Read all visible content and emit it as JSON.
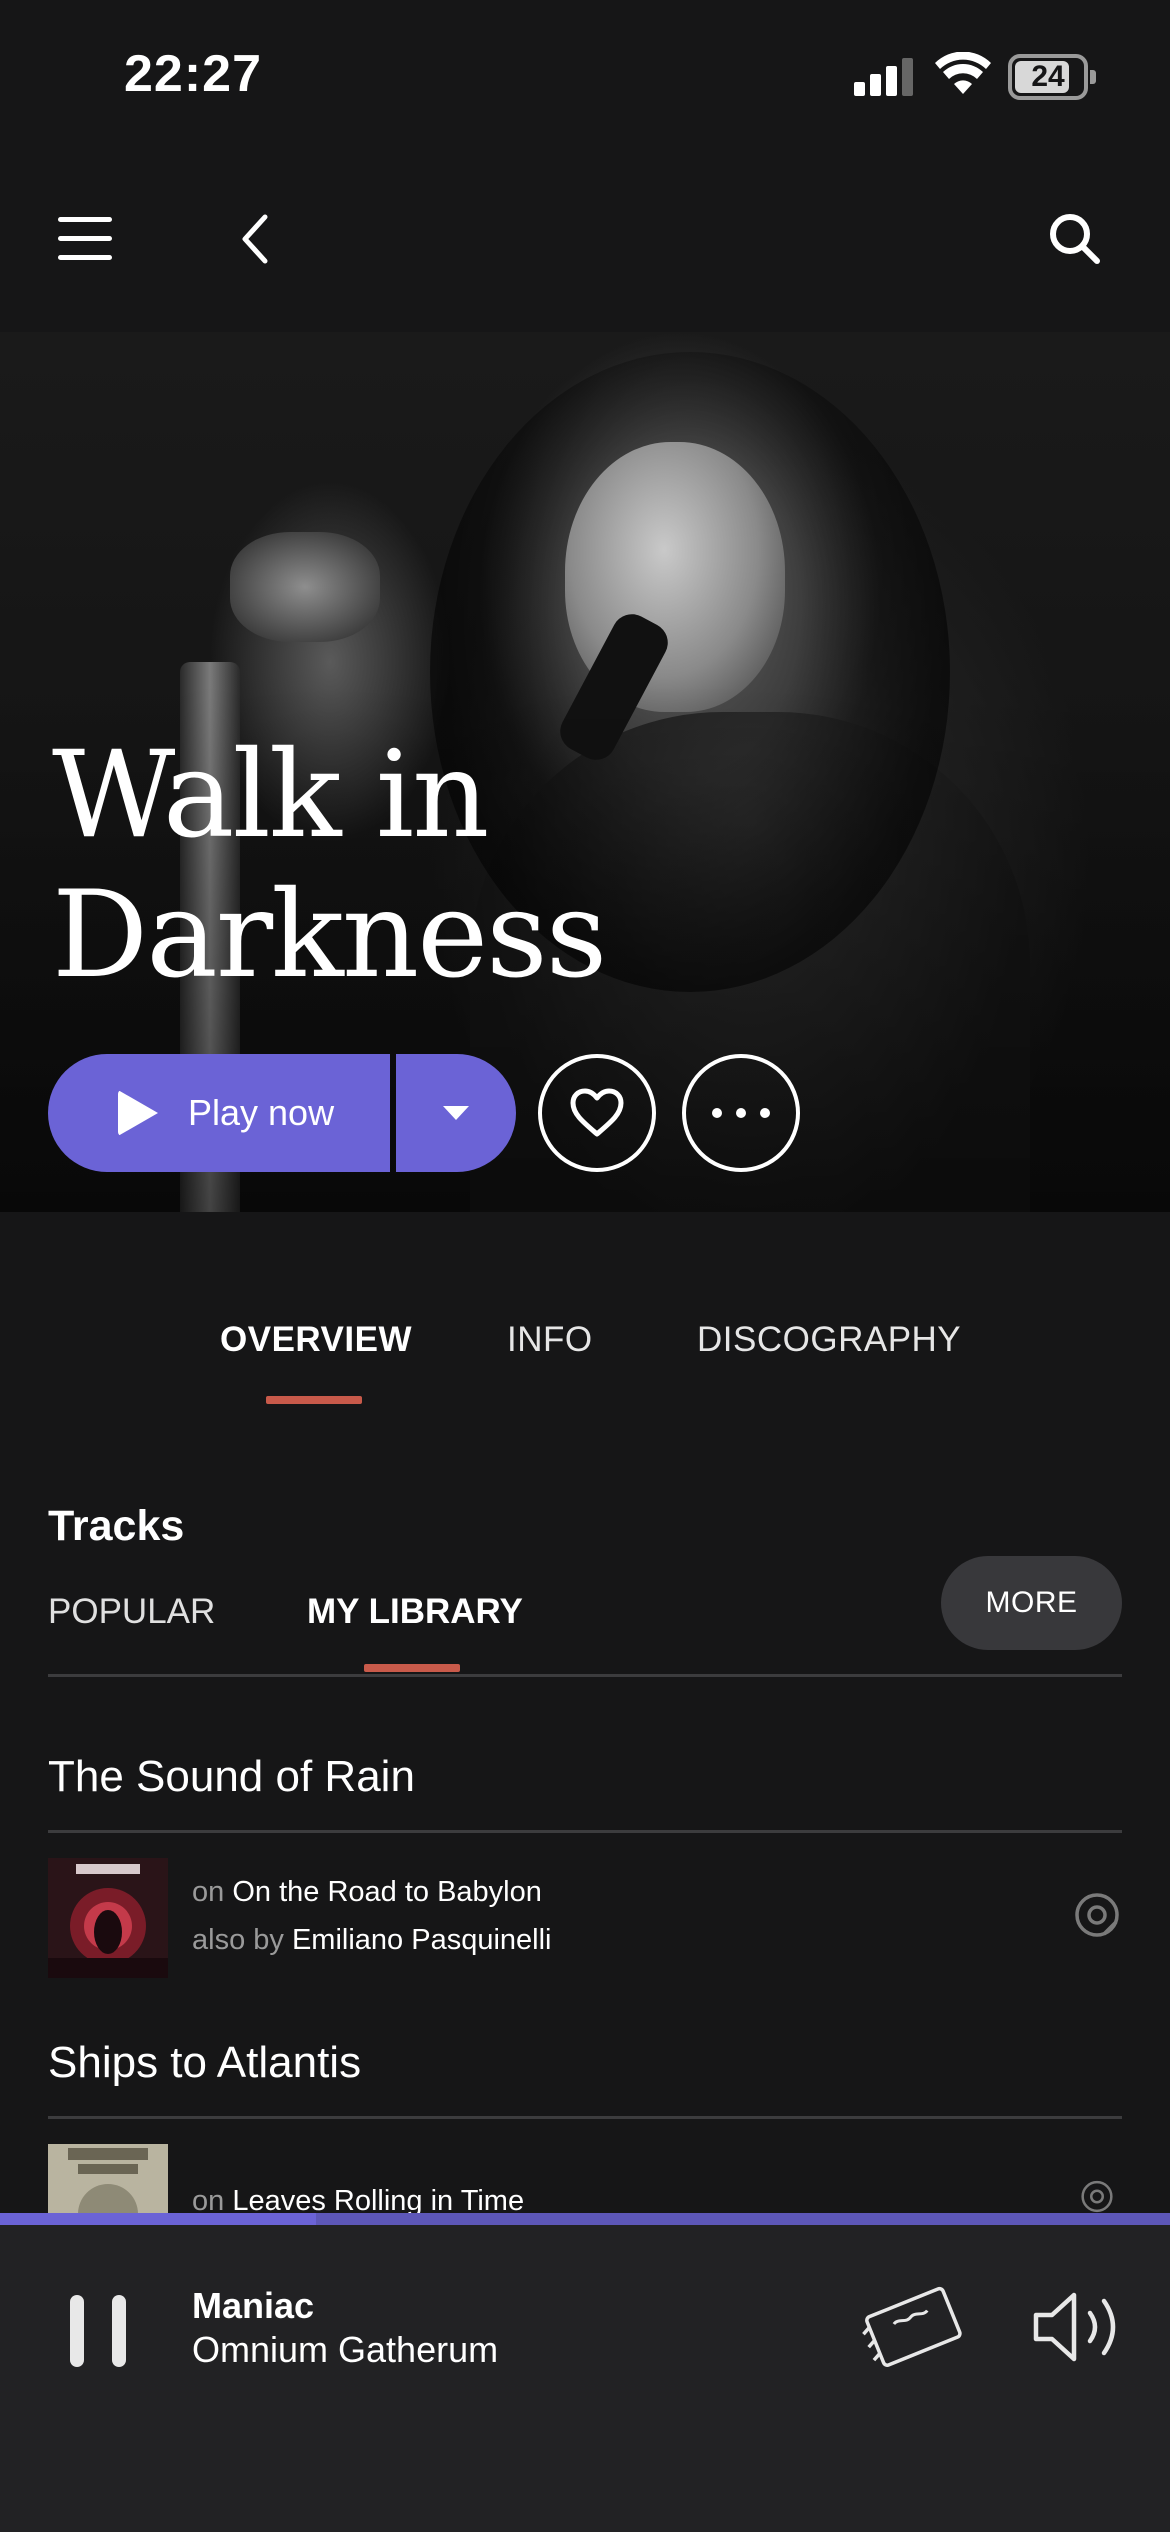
{
  "status_bar": {
    "time": "22:27",
    "battery": "24"
  },
  "artist": {
    "name_line1": "Walk in",
    "name_line2": "Darkness"
  },
  "actions": {
    "play_label": "Play now"
  },
  "tabs": [
    {
      "label": "OVERVIEW",
      "active": true
    },
    {
      "label": "INFO",
      "active": false
    },
    {
      "label": "DISCOGRAPHY",
      "active": false
    }
  ],
  "tracks_section": {
    "title": "Tracks",
    "subtabs": [
      {
        "label": "POPULAR",
        "active": false
      },
      {
        "label": "MY LIBRARY",
        "active": true
      }
    ],
    "more_label": "MORE",
    "items": [
      {
        "title": "The Sound of Rain",
        "on_prefix": "on",
        "album": "On the Road to Babylon",
        "also_prefix": "also by",
        "also_artist": "Emiliano Pasquinelli"
      },
      {
        "title": "Ships to Atlantis",
        "on_prefix": "on",
        "album": "Leaves Rolling in Time"
      }
    ]
  },
  "now_playing": {
    "title": "Maniac",
    "artist": "Omnium Gatherum",
    "progress": 0.27
  },
  "colors": {
    "accent": "#6b63d6",
    "tab_underline": "#c85a4a",
    "background": "#161617",
    "player_bg": "#222224"
  }
}
